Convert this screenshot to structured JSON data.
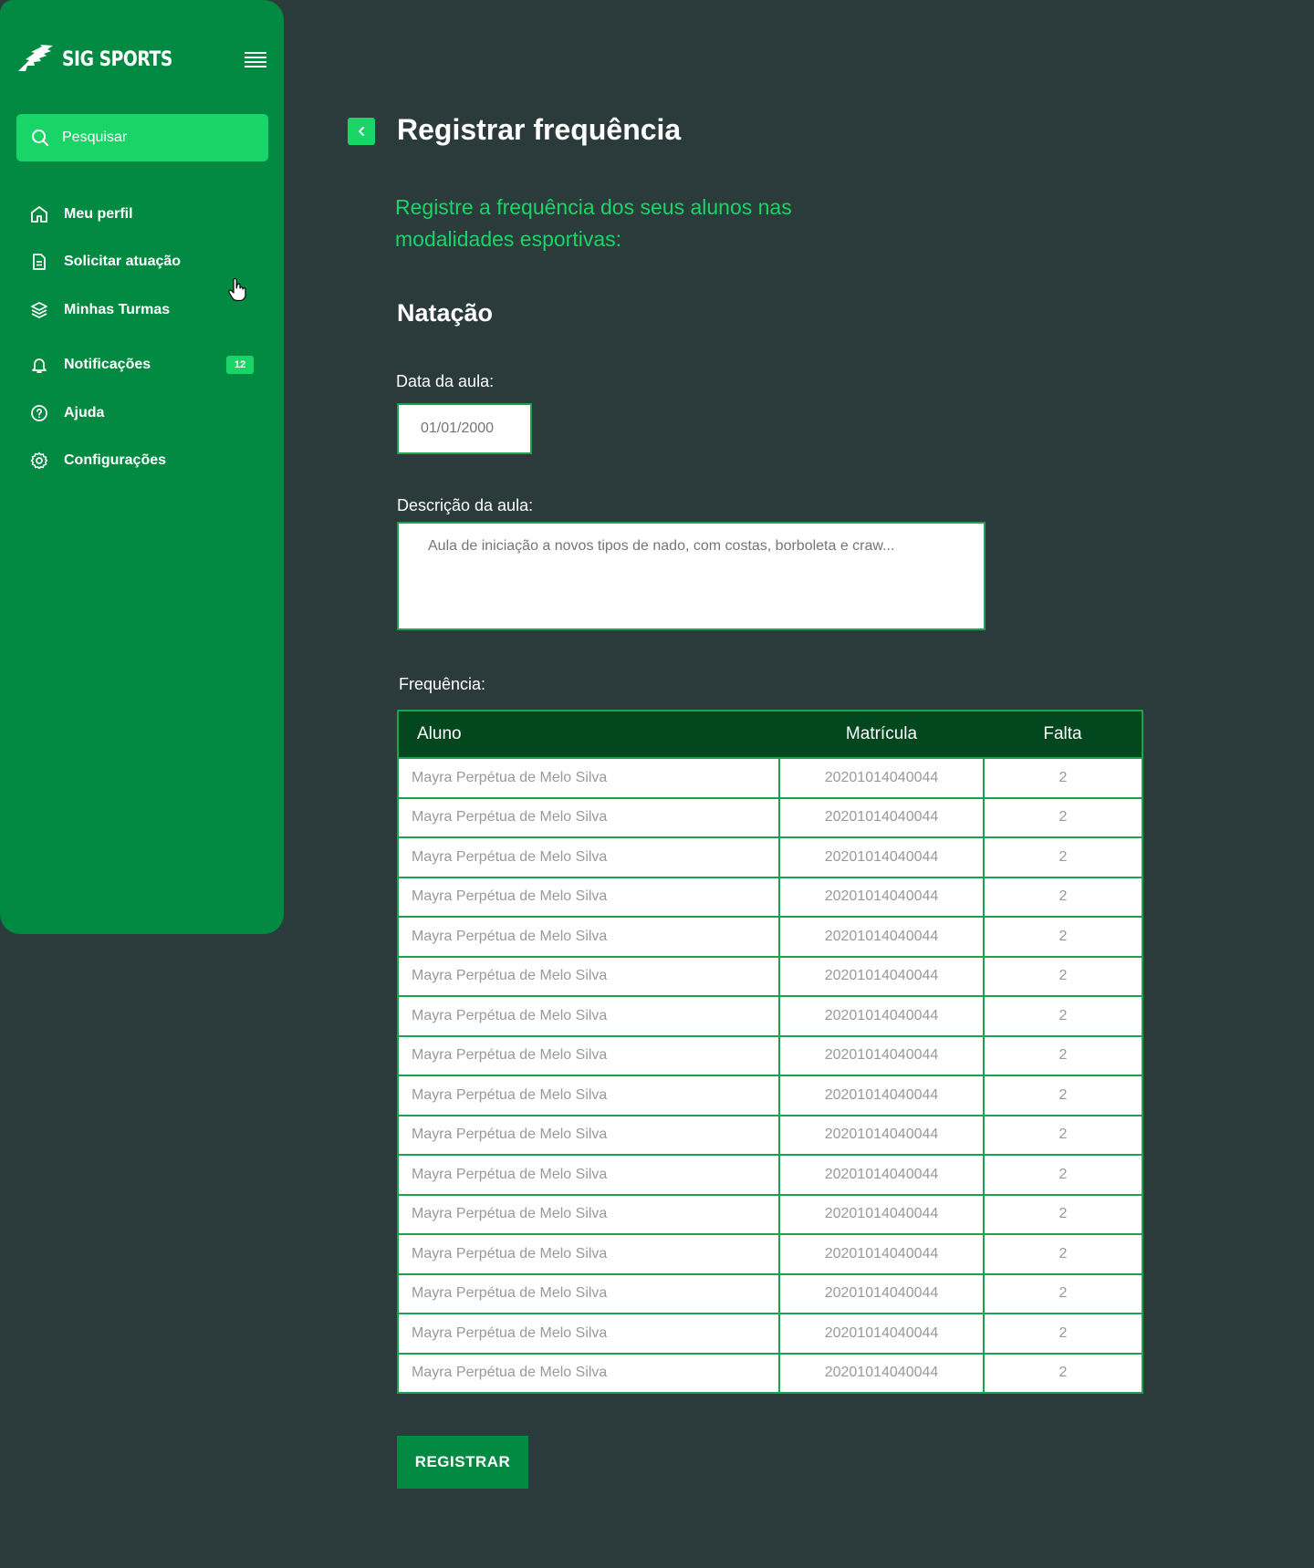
{
  "sidebar": {
    "brand": "SIG SPORTS",
    "search_placeholder": "Pesquisar",
    "items": [
      {
        "label": "Meu perfil",
        "icon": "home-icon"
      },
      {
        "label": "Solicitar atuação",
        "icon": "document-icon"
      },
      {
        "label": "Minhas Turmas",
        "icon": "layers-icon"
      },
      {
        "label": "Notificações",
        "icon": "bell-icon",
        "badge": "12"
      },
      {
        "label": "Ajuda",
        "icon": "help-circle-icon"
      },
      {
        "label": "Configurações",
        "icon": "gear-icon"
      }
    ]
  },
  "header": {
    "title": "Registrar frequência"
  },
  "intro": "Registre a frequência dos seus alunos nas modalidades esportivas:",
  "section_title": "Natação",
  "form": {
    "date_label": "Data da aula:",
    "date_placeholder": "01/01/2000",
    "desc_label": "Descrição da aula:",
    "desc_placeholder": "Aula de iniciação a novos tipos de nado, com costas, borboleta e craw...",
    "freq_label": "Frequência:"
  },
  "table": {
    "headers": [
      "Aluno",
      "Matrícula",
      "Falta"
    ],
    "rows": [
      [
        "Mayra Perpétua de Melo Silva",
        "20201014040044",
        "2"
      ],
      [
        "Mayra Perpétua de Melo Silva",
        "20201014040044",
        "2"
      ],
      [
        "Mayra Perpétua de Melo Silva",
        "20201014040044",
        "2"
      ],
      [
        "Mayra Perpétua de Melo Silva",
        "20201014040044",
        "2"
      ],
      [
        "Mayra Perpétua de Melo Silva",
        "20201014040044",
        "2"
      ],
      [
        "Mayra Perpétua de Melo Silva",
        "20201014040044",
        "2"
      ],
      [
        "Mayra Perpétua de Melo Silva",
        "20201014040044",
        "2"
      ],
      [
        "Mayra Perpétua de Melo Silva",
        "20201014040044",
        "2"
      ],
      [
        "Mayra Perpétua de Melo Silva",
        "20201014040044",
        "2"
      ],
      [
        "Mayra Perpétua de Melo Silva",
        "20201014040044",
        "2"
      ],
      [
        "Mayra Perpétua de Melo Silva",
        "20201014040044",
        "2"
      ],
      [
        "Mayra Perpétua de Melo Silva",
        "20201014040044",
        "2"
      ],
      [
        "Mayra Perpétua de Melo Silva",
        "20201014040044",
        "2"
      ],
      [
        "Mayra Perpétua de Melo Silva",
        "20201014040044",
        "2"
      ],
      [
        "Mayra Perpétua de Melo Silva",
        "20201014040044",
        "2"
      ],
      [
        "Mayra Perpétua de Melo Silva",
        "20201014040044",
        "2"
      ]
    ]
  },
  "submit_label": "REGISTRAR",
  "colors": {
    "background": "#2b3a3a",
    "sidebar": "#038a42",
    "accent": "#19d466",
    "table_header": "#03471f"
  }
}
